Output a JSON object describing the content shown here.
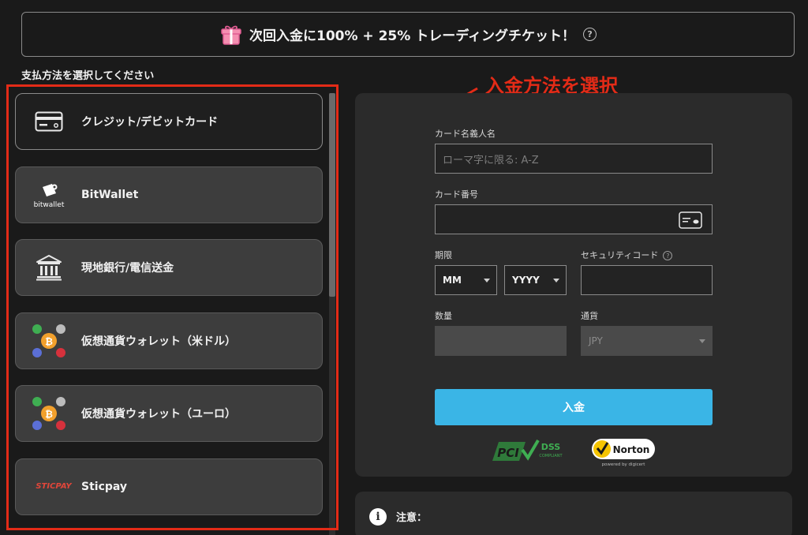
{
  "promo": {
    "text": "次回入金に100% + 25% トレーディングチケット！",
    "help_icon": "?",
    "icon": "gift-icon"
  },
  "payment_section_label": "支払方法を選択してください",
  "annotation": {
    "text": "入金方法を選択",
    "color": "#e32b17"
  },
  "methods": [
    {
      "label": "クレジット/デビットカード",
      "icon": "credit-card-icon",
      "selected": true
    },
    {
      "label": "BitWallet",
      "icon": "bitwallet-logo",
      "logo_text": "bitwallet"
    },
    {
      "label": "現地銀行/電信送金",
      "icon": "bank-icon"
    },
    {
      "label": "仮想通貨ウォレット（米ドル）",
      "icon": "crypto-icon"
    },
    {
      "label": "仮想通貨ウォレット（ユーロ）",
      "icon": "crypto-icon"
    },
    {
      "label": "Sticpay",
      "icon": "sticpay-logo",
      "logo_text": "STICPAY"
    }
  ],
  "form": {
    "cardholder_label": "カード名義人名",
    "cardholder_placeholder": "ローマ字に限る: A-Z",
    "card_number_label": "カード番号",
    "card_number_value": "",
    "expiry_label": "期限",
    "expiry_month": "MM",
    "expiry_year": "YYYY",
    "security_label": "セキュリティコード",
    "security_help": "?",
    "security_value": "",
    "amount_label": "数量",
    "amount_value": "",
    "currency_label": "通貨",
    "currency_value": "JPY",
    "submit_label": "入金",
    "submit_color": "#3ab5e6"
  },
  "badges": {
    "pci_text": "PCI",
    "pci_sub": "DSS",
    "pci_compliant": "COMPLIANT",
    "norton_text": "Norton",
    "norton_sub": "powered by digicert"
  },
  "notice": {
    "label": "注意：",
    "icon": "info-icon"
  }
}
